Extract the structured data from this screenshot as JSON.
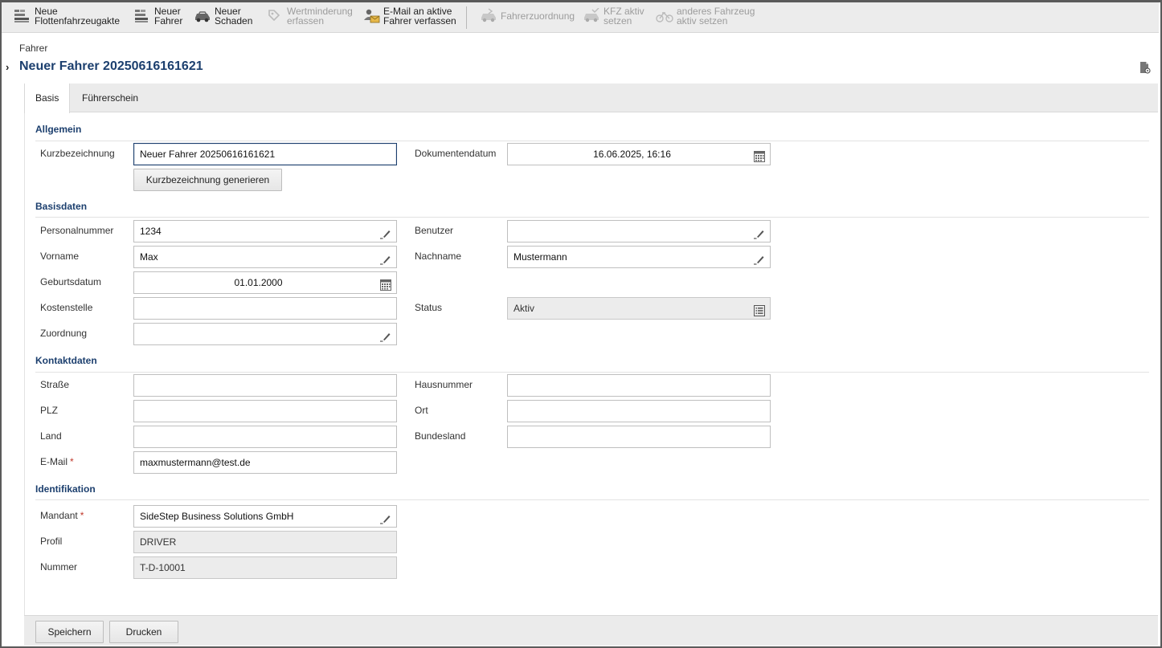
{
  "toolbar": {
    "items": [
      {
        "line1": "Neue",
        "line2": "Flottenfahrzeugakte",
        "icon": "fleet-file-icon",
        "enabled": true
      },
      {
        "line1": "Neuer",
        "line2": "Fahrer",
        "icon": "new-driver-icon",
        "enabled": true
      },
      {
        "line1": "Neuer",
        "line2": "Schaden",
        "icon": "car-damage-icon",
        "enabled": true
      },
      {
        "line1": "Wertminderung",
        "line2": "erfassen",
        "icon": "depreciation-icon",
        "enabled": false
      },
      {
        "line1": "E-Mail an aktive",
        "line2": "Fahrer verfassen",
        "icon": "email-drivers-icon",
        "enabled": true
      },
      {
        "line1": "Fahrerzuordnung",
        "line2": "",
        "icon": "driver-assignment-icon",
        "enabled": false
      },
      {
        "line1": "KFZ aktiv",
        "line2": "setzen",
        "icon": "car-active-icon",
        "enabled": false
      },
      {
        "line1": "anderes Fahrzeug",
        "line2": "aktiv setzen",
        "icon": "other-vehicle-icon",
        "enabled": false
      }
    ]
  },
  "header": {
    "breadcrumb": "Fahrer",
    "title": "Neuer Fahrer 20250616161621"
  },
  "tabs": [
    {
      "label": "Basis",
      "active": true
    },
    {
      "label": "Führerschein",
      "active": false
    }
  ],
  "sections": {
    "allgemein": "Allgemein",
    "basisdaten": "Basisdaten",
    "kontaktdaten": "Kontaktdaten",
    "identifikation": "Identifikation"
  },
  "form": {
    "kurzbezeichnung": {
      "label": "Kurzbezeichnung",
      "value": "Neuer Fahrer 20250616161621"
    },
    "generate_button": "Kurzbezeichnung generieren",
    "dokumentendatum": {
      "label": "Dokumentendatum",
      "value": "16.06.2025, 16:16"
    },
    "personalnummer": {
      "label": "Personalnummer",
      "value": "1234"
    },
    "benutzer": {
      "label": "Benutzer",
      "value": ""
    },
    "vorname": {
      "label": "Vorname",
      "value": "Max"
    },
    "nachname": {
      "label": "Nachname",
      "value": "Mustermann"
    },
    "geburtsdatum": {
      "label": "Geburtsdatum",
      "value": "01.01.2000"
    },
    "kostenstelle": {
      "label": "Kostenstelle",
      "value": ""
    },
    "status": {
      "label": "Status",
      "value": "Aktiv"
    },
    "zuordnung": {
      "label": "Zuordnung",
      "value": ""
    },
    "strasse": {
      "label": "Straße",
      "value": ""
    },
    "hausnummer": {
      "label": "Hausnummer",
      "value": ""
    },
    "plz": {
      "label": "PLZ",
      "value": ""
    },
    "ort": {
      "label": "Ort",
      "value": ""
    },
    "land": {
      "label": "Land",
      "value": ""
    },
    "bundesland": {
      "label": "Bundesland",
      "value": ""
    },
    "email": {
      "label": "E-Mail",
      "value": "maxmustermann@test.de",
      "required_mark": "*"
    },
    "mandant": {
      "label": "Mandant",
      "value": "SideStep Business Solutions GmbH",
      "required_mark": "*"
    },
    "profil": {
      "label": "Profil",
      "value": "DRIVER"
    },
    "nummer": {
      "label": "Nummer",
      "value": "T-D-10001"
    }
  },
  "footer": {
    "save_label": "Speichern",
    "print_label": "Drucken"
  },
  "colors": {
    "accent": "#1c3f6e",
    "required": "#c0392b",
    "toolbar_bg": "#ececec"
  }
}
